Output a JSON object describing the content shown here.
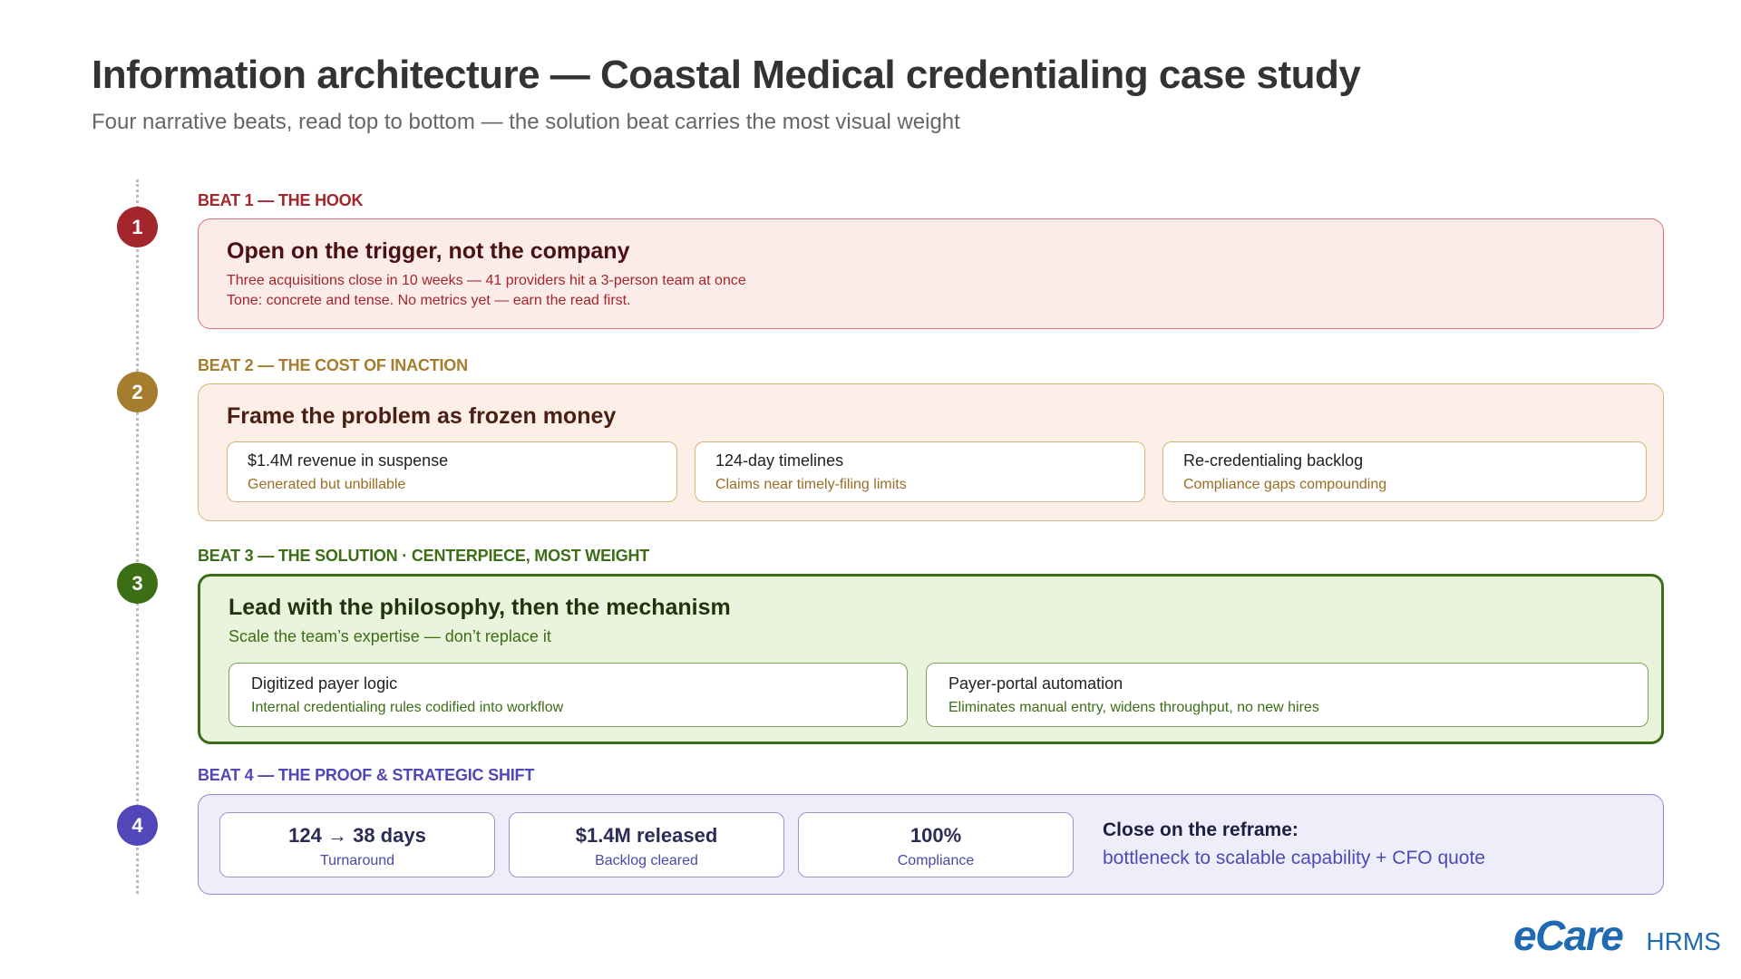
{
  "header": {
    "title": "Information architecture — Coastal Medical credentialing case study",
    "subtitle": "Four narrative beats, read top to bottom — the solution beat carries the most visual weight"
  },
  "beats": [
    {
      "number": "1",
      "label": "BEAT 1 — THE HOOK",
      "heading": "Open on the trigger, not the company",
      "lines": [
        "Three acquisitions close in 10 weeks — 41 providers hit a 3-person team at once",
        "Tone: concrete and tense. No metrics yet — earn the read first."
      ]
    },
    {
      "number": "2",
      "label": "BEAT 2 — THE COST OF INACTION",
      "heading": "Frame the problem as frozen money",
      "cards": [
        {
          "title": "$1.4M revenue in suspense",
          "text": "Generated but unbillable"
        },
        {
          "title": "124-day timelines",
          "text": "Claims near timely-filing limits"
        },
        {
          "title": "Re-credentialing backlog",
          "text": "Compliance gaps compounding"
        }
      ]
    },
    {
      "number": "3",
      "label": "BEAT 3 — THE SOLUTION · CENTERPIECE, MOST WEIGHT",
      "heading": "Lead with the philosophy, then the mechanism",
      "tagline": "Scale the team’s expertise — don’t replace it",
      "cards": [
        {
          "title": "Digitized payer logic",
          "text": "Internal credentialing rules codified into workflow"
        },
        {
          "title": "Payer-portal automation",
          "text": "Eliminates manual entry, widens throughput, no new hires"
        }
      ]
    },
    {
      "number": "4",
      "label": "BEAT 4 — THE PROOF & STRATEGIC SHIFT",
      "metrics": [
        {
          "value": "124 → 38 days",
          "label": "Turnaround"
        },
        {
          "value": "$1.4M released",
          "label": "Backlog cleared"
        },
        {
          "value": "100%",
          "label": "Compliance"
        }
      ],
      "close_heading": "Close on the reframe:",
      "close_text": "bottleneck to scalable capability + CFO quote"
    }
  ],
  "brand": {
    "logo": "eCare",
    "product": "HRMS"
  },
  "colors": {
    "beat1": "#a3262c",
    "beat2": "#a67c2e",
    "beat3": "#3b6e15",
    "beat4": "#5247b8"
  }
}
